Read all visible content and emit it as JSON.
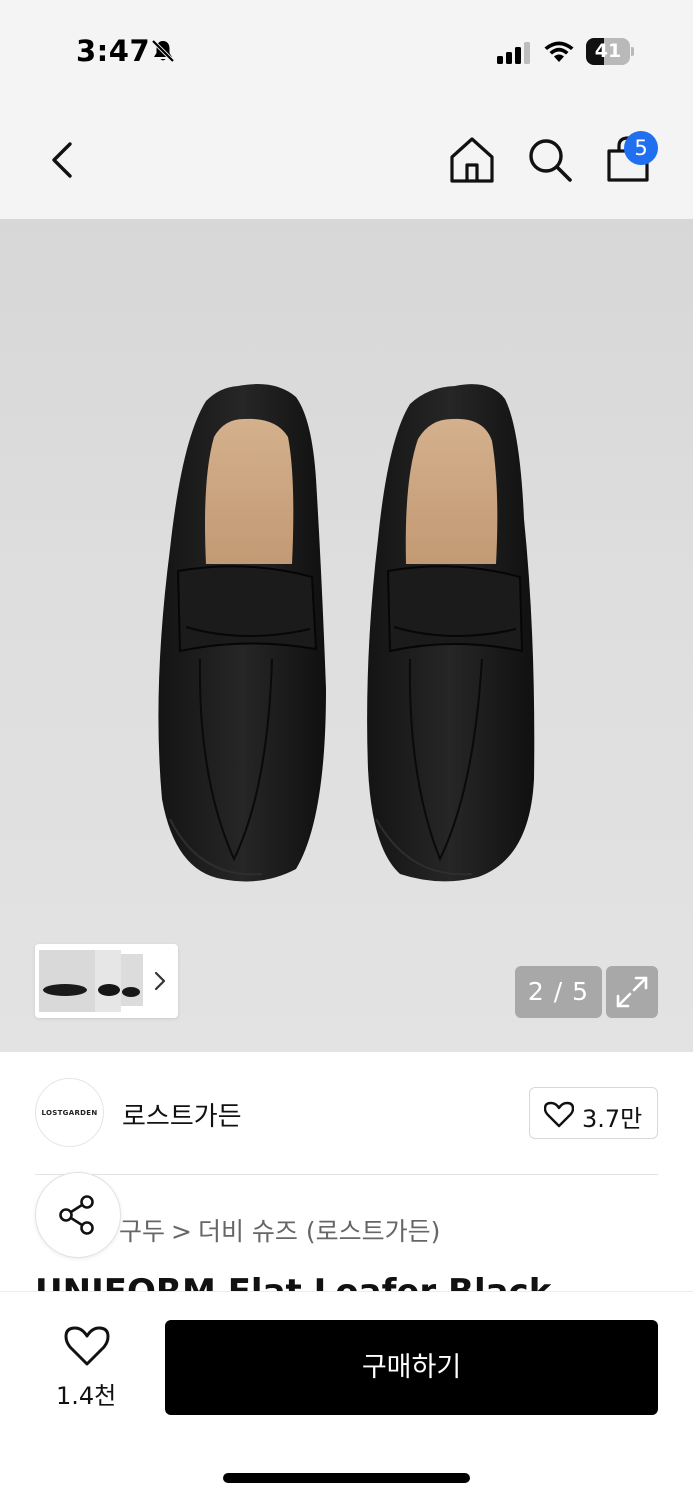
{
  "status_bar": {
    "time": "3:47",
    "battery_level": "41",
    "battery_fraction": 0.41,
    "icons": [
      "bell-slash-icon",
      "signal-icon",
      "wifi-icon",
      "battery-icon"
    ]
  },
  "nav": {
    "icons": [
      "chevron-left-icon",
      "home-icon",
      "search-icon",
      "shopping-bag-icon"
    ],
    "cart_badge": "5",
    "badge_color": "#1f6ff0"
  },
  "gallery": {
    "counter": "2 / 5",
    "icons": [
      "chevron-right-icon",
      "expand-icon"
    ]
  },
  "brand": {
    "logo_text": "LOSTGARDEN",
    "name": "로스트가든",
    "favorite_count": "3.7만"
  },
  "breadcrumb": {
    "items": [
      "구두",
      "더비 슈즈 (로스트가든)"
    ],
    "separator": ">"
  },
  "product": {
    "title": "UNIFORM Flat Loafer Black"
  },
  "bottom_bar": {
    "wish_count": "1.4천",
    "buy_label": "구매하기",
    "buy_color": "#000000"
  }
}
